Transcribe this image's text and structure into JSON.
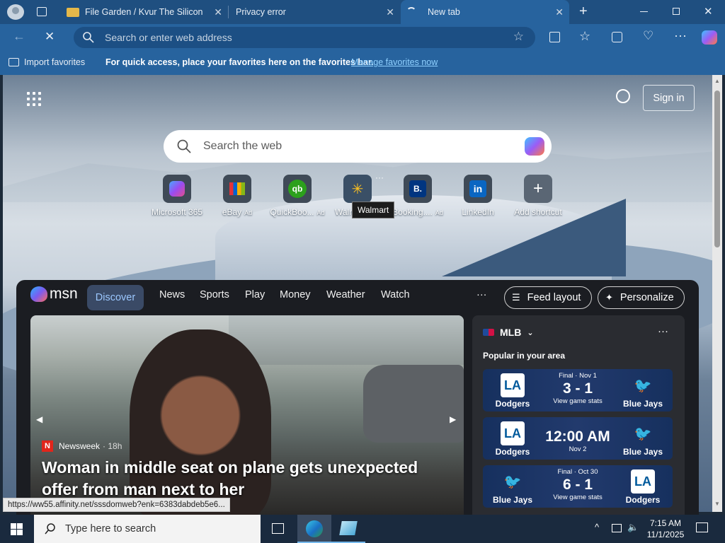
{
  "tabs": [
    {
      "title": "File Garden / Kvur The Silicon"
    },
    {
      "title": "Privacy error"
    },
    {
      "title": "New tab"
    }
  ],
  "address_bar": {
    "placeholder": "Search or enter web address"
  },
  "favorites_bar": {
    "import_label": "Import favorites",
    "message": "For quick access, place your favorites here on the favorites bar.",
    "manage_link": "Manage favorites now"
  },
  "newtab": {
    "sign_in": "Sign in",
    "search_placeholder": "Search the web",
    "shortcuts": [
      {
        "label": "Microsoft 365",
        "ad": ""
      },
      {
        "label": "eBay",
        "ad": "Ad"
      },
      {
        "label": "QuickBoo...",
        "ad": "Ad"
      },
      {
        "label": "Walm",
        "ad": ""
      },
      {
        "label": "Booking....",
        "ad": "Ad"
      },
      {
        "label": "LinkedIn",
        "ad": ""
      },
      {
        "label": "Add shortcut",
        "ad": ""
      }
    ],
    "tooltip": "Walmart"
  },
  "feed": {
    "brand": "msn",
    "nav": [
      "Discover",
      "News",
      "Sports",
      "Play",
      "Money",
      "Weather",
      "Watch"
    ],
    "more": "···",
    "feed_layout": "Feed layout",
    "personalize": "Personalize",
    "hero": {
      "source": "Newsweek",
      "age": "· 18h",
      "headline_line1": "Woman in middle seat on plane gets unexpected",
      "headline_line2": "offer from man next to her"
    },
    "sports": {
      "league": "MLB",
      "subtitle": "Popular in your area",
      "games": [
        {
          "status": "Final · Nov 1",
          "score": "3 - 1",
          "note": "View game stats",
          "home": "Dodgers",
          "away": "Blue Jays",
          "home_logo": "LA",
          "away_logo": "jays"
        },
        {
          "status": "",
          "score": "12:00 AM",
          "note": "Nov 2",
          "home": "Dodgers",
          "away": "Blue Jays",
          "home_logo": "LA",
          "away_logo": "jays"
        },
        {
          "status": "Final · Oct 30",
          "score": "6 - 1",
          "note": "View game stats",
          "home": "Blue Jays",
          "away": "Dodgers",
          "home_logo": "jays",
          "away_logo": "LA"
        }
      ]
    }
  },
  "status_url": "https://ww55.affinity.net/sssdomweb?enk=6383dabdeb5e6...",
  "taskbar": {
    "search_placeholder": "Type here to search",
    "time": "7:15 AM",
    "date": "11/1/2025"
  }
}
